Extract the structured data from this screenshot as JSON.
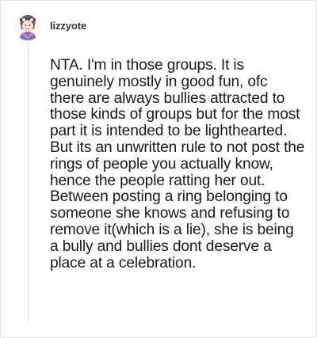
{
  "post": {
    "username": "lizzyote",
    "avatar_icon": "avatar-illustration-icon",
    "body": "NTA. I'm in those groups. It is genuinely mostly in good fun, ofc there are always bullies attracted to those kinds of groups but for the most part it is intended to be lighthearted. But its an unwritten rule to not post the rings of people you actually know, hence the people ratting her out. Between posting a ring belonging to someone she knows and refusing to remove it(which is a lie), she is being a bully and bullies dont deserve a place at a celebration."
  },
  "colors": {
    "text": "#1a1a1a",
    "username": "#333333",
    "border": "#e3e3e3"
  }
}
